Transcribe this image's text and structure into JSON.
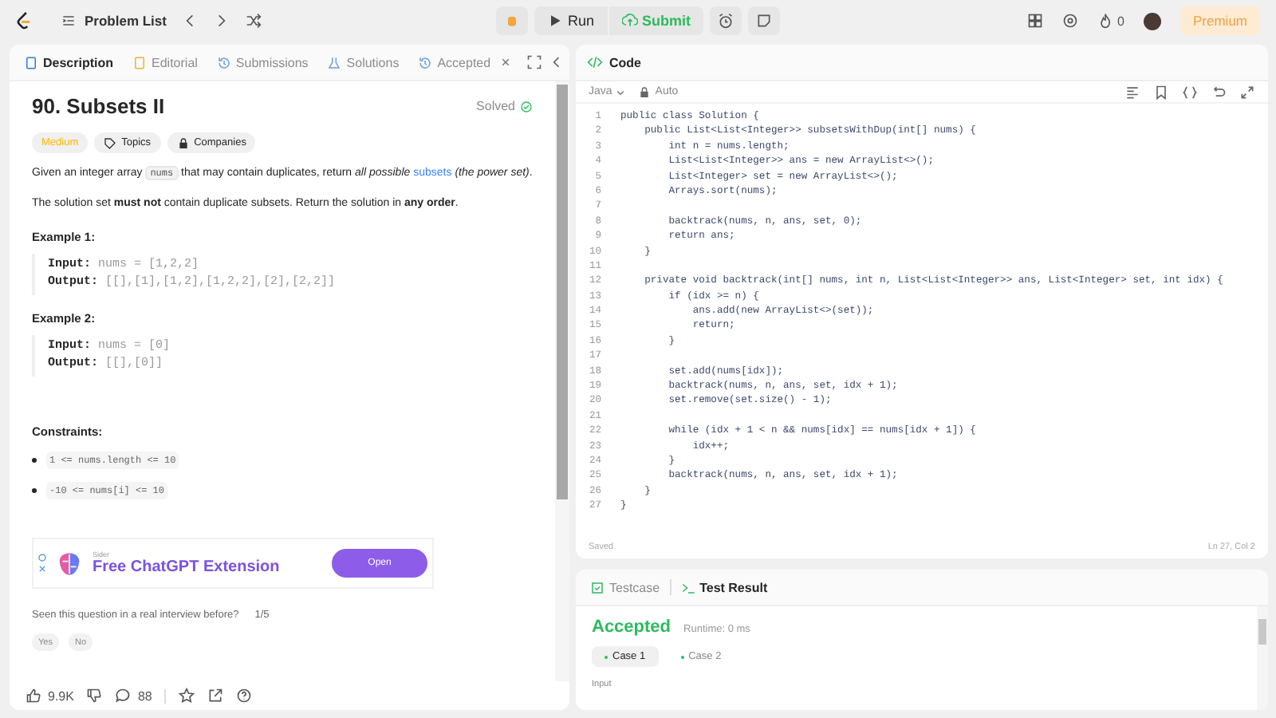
{
  "topbar": {
    "problem_list": "Problem List",
    "run": "Run",
    "submit": "Submit",
    "streak": "0",
    "premium": "Premium"
  },
  "left_tabs": [
    {
      "kind": "description",
      "label": "Description",
      "selected": true,
      "closable": false
    },
    {
      "kind": "editorial",
      "label": "Editorial",
      "selected": false,
      "closable": false
    },
    {
      "kind": "submissions",
      "label": "Submissions",
      "selected": false,
      "closable": false
    },
    {
      "kind": "solutions",
      "label": "Solutions",
      "selected": false,
      "closable": false
    },
    {
      "kind": "accepted",
      "label": "Accepted",
      "selected": false,
      "closable": true
    }
  ],
  "problem": {
    "title": "90. Subsets II",
    "status": "Solved",
    "difficulty": "Medium",
    "tags": [
      "Topics",
      "Companies"
    ],
    "statement": [
      {
        "kind": "text",
        "text": "Given an integer array "
      },
      {
        "kind": "code",
        "text": "nums"
      },
      {
        "kind": "text",
        "text": " that may contain duplicates, return *all possible* "
      },
      {
        "kind": "link",
        "text": "subsets"
      },
      {
        "kind": "text",
        "text": " *(the power set)*."
      }
    ],
    "note": "The solution set **must not** contain duplicate subsets. Return the solution in **any order**.",
    "examples": [
      {
        "title": "Example 1:",
        "lines": [
          "**Input:** nums = [1,2,2]",
          "**Output:** [[],[1],[1,2],[1,2,2],[2],[2,2]]"
        ]
      },
      {
        "title": "Example 2:",
        "lines": [
          "**Input:** nums = [0]",
          "**Output:** [[],[0]]"
        ]
      }
    ],
    "constraints_title": "Constraints:",
    "constraints": [
      "1 <= nums.length <= 10",
      "-10 <= nums[i] <= 10"
    ]
  },
  "ad": {
    "brand": "Sider",
    "headline": "Free ChatGPT Extension",
    "button": "Open"
  },
  "interview": {
    "question": "Seen this question in a real interview before?",
    "count": "1/5",
    "answers": [
      "Yes",
      "No"
    ]
  },
  "actions": {
    "likes": "9.9K",
    "comments": "88"
  },
  "code_panel": {
    "title": "Code",
    "language": "Java",
    "mode": "Auto",
    "saved": "Saved",
    "cursor": "Ln 27, Col 2",
    "lines": [
      {
        "n": "1",
        "code": "public class Solution {"
      },
      {
        "n": "2",
        "code": "    public List<List<Integer>> subsetsWithDup(int[] nums) {"
      },
      {
        "n": "3",
        "code": "        int n = nums.length;"
      },
      {
        "n": "4",
        "code": "        List<List<Integer>> ans = new ArrayList<>();"
      },
      {
        "n": "5",
        "code": "        List<Integer> set = new ArrayList<>();"
      },
      {
        "n": "6",
        "code": "        Arrays.sort(nums);"
      },
      {
        "n": "7"
      },
      {
        "n": "8",
        "code": "        backtrack(nums, n, ans, set, 0);"
      },
      {
        "n": "9",
        "code": "        return ans;"
      },
      {
        "n": "10",
        "code": "    }"
      },
      {
        "n": "11"
      },
      {
        "n": "12",
        "code": "    private void backtrack(int[] nums, int n, List<List<Integer>> ans, List<Integer> set, int idx) {"
      },
      {
        "n": "13",
        "code": "        if (idx >= n) {"
      },
      {
        "n": "14",
        "code": "            ans.add(new ArrayList<>(set));"
      },
      {
        "n": "15",
        "code": "            return;"
      },
      {
        "n": "16",
        "code": "        }"
      },
      {
        "n": "17"
      },
      {
        "n": "18",
        "code": "        set.add(nums[idx]);"
      },
      {
        "n": "19",
        "code": "        backtrack(nums, n, ans, set, idx + 1);"
      },
      {
        "n": "20",
        "code": "        set.remove(set.size() - 1);"
      },
      {
        "n": "21"
      },
      {
        "n": "22",
        "code": "        while (idx + 1 < n && nums[idx] == nums[idx + 1]) {"
      },
      {
        "n": "23",
        "code": "            idx++;"
      },
      {
        "n": "24",
        "code": "        }"
      },
      {
        "n": "25",
        "code": "        backtrack(nums, n, ans, set, idx + 1);"
      },
      {
        "n": "26",
        "code": "    }"
      },
      {
        "n": "27",
        "code": "}"
      }
    ]
  },
  "result_tabs": [
    {
      "label": "Testcase",
      "selected": false
    },
    {
      "label": "Test Result",
      "selected": true
    }
  ],
  "result": {
    "status": "Accepted",
    "runtime": "Runtime: 0 ms",
    "cases": [
      {
        "label": "Case 1",
        "selected": true
      },
      {
        "label": "Case 2",
        "selected": false
      }
    ],
    "input_label": "Input"
  }
}
